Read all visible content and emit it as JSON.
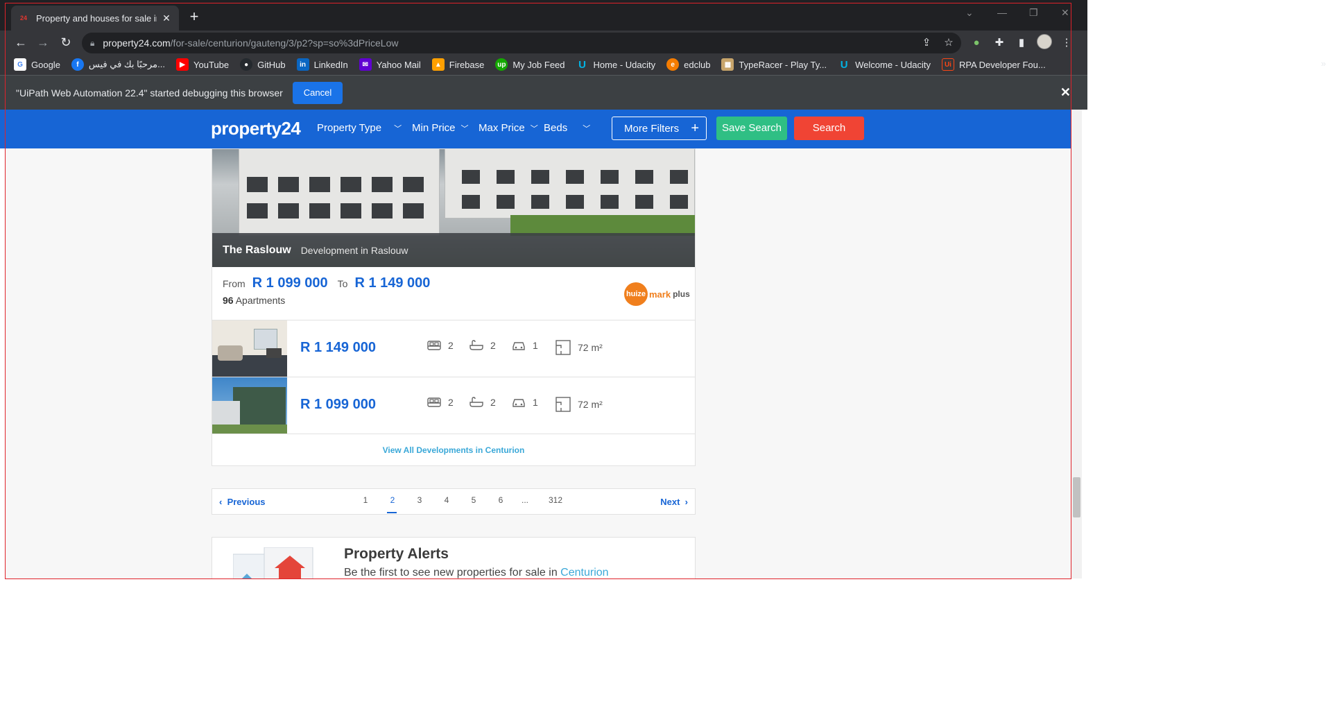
{
  "browser": {
    "tab": {
      "title": "Property and houses for sale in C",
      "favicon_text": "24"
    },
    "url_host": "property24.com",
    "url_path": "/for-sale/centurion/gauteng/3/p2?sp=so%3dPriceLow",
    "bookmarks": [
      {
        "label": "Google",
        "icon": "google-icon",
        "color": "#ffffff"
      },
      {
        "label": "مرحبًا بك في فيس...",
        "icon": "facebook-icon",
        "color": "#1877f2"
      },
      {
        "label": "YouTube",
        "icon": "youtube-icon",
        "color": "#ff0000"
      },
      {
        "label": "GitHub",
        "icon": "github-icon",
        "color": "#24292e"
      },
      {
        "label": "LinkedIn",
        "icon": "linkedin-icon",
        "color": "#0a66c2"
      },
      {
        "label": "Yahoo Mail",
        "icon": "yahoo-icon",
        "color": "#6001d2"
      },
      {
        "label": "Firebase",
        "icon": "firebase-icon",
        "color": "#ffa000"
      },
      {
        "label": "My Job Feed",
        "icon": "upwork-icon",
        "color": "#14a800"
      },
      {
        "label": "Home - Udacity",
        "icon": "udacity-icon",
        "color": "#02b3e4"
      },
      {
        "label": "edclub",
        "icon": "edclub-icon",
        "color": "#f57c00"
      },
      {
        "label": "TypeRacer - Play Ty...",
        "icon": "typeracer-icon",
        "color": "#c7a46a"
      },
      {
        "label": "Welcome - Udacity",
        "icon": "udacity-icon",
        "color": "#02b3e4"
      },
      {
        "label": "RPA Developer Fou...",
        "icon": "uipath-icon",
        "color": "#fa4616"
      }
    ],
    "bookmarks_overflow": "»",
    "infobar": {
      "message": "\"UiPath Web Automation 22.4\" started debugging this browser",
      "cancel_label": "Cancel"
    }
  },
  "site": {
    "logo": "property24",
    "nav": [
      {
        "label": "Property Type"
      },
      {
        "label": "Min Price"
      },
      {
        "label": "Max Price"
      },
      {
        "label": "Beds"
      }
    ],
    "more_filters_label": "More Filters",
    "save_search_label": "Save Search",
    "search_label": "Search",
    "accent": "#1765d5"
  },
  "development": {
    "name": "The Raslouw",
    "subtitle": "Development in Raslouw",
    "from_label": "From",
    "from_price": "R 1 099 000",
    "to_label": "To",
    "to_price": "R 1 149 000",
    "apartments_count": "96",
    "apartments_label": "Apartments",
    "agent_logo": {
      "circle": "huize",
      "mark": "mark",
      "plus": "plus"
    },
    "units": [
      {
        "price": "R 1 149 000",
        "beds": "2",
        "baths": "2",
        "parking": "1",
        "size": "72 m²"
      },
      {
        "price": "R 1 099 000",
        "beds": "2",
        "baths": "2",
        "parking": "1",
        "size": "72 m²"
      }
    ],
    "view_all_label": "View All Developments in Centurion"
  },
  "pagination": {
    "previous_label": "Previous",
    "next_label": "Next",
    "pages": [
      "1",
      "2",
      "3",
      "4",
      "5",
      "6",
      "...",
      "312"
    ],
    "current": "2"
  },
  "alerts": {
    "title": "Property Alerts",
    "desc_prefix": "Be the first to see new properties for sale in",
    "desc_link": "Centurion"
  }
}
